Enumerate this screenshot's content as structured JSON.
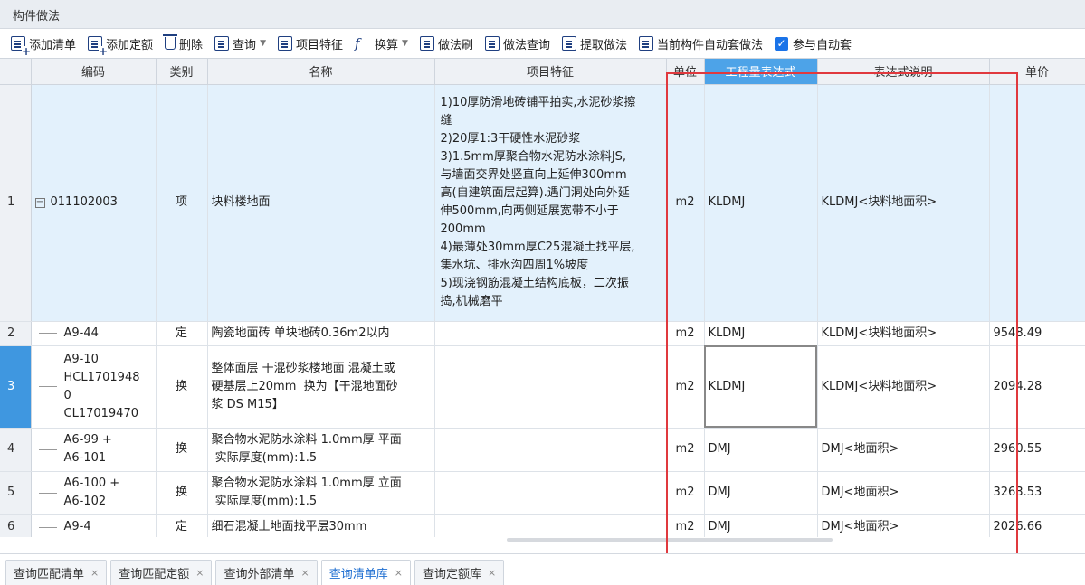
{
  "panel": {
    "title": "构件做法"
  },
  "toolbar": {
    "items": [
      {
        "label": "添加清单",
        "icon": "add-list-icon"
      },
      {
        "label": "添加定额",
        "icon": "add-quota-icon"
      },
      {
        "label": "删除",
        "icon": "trash-icon"
      },
      {
        "label": "查询",
        "icon": "query-icon"
      },
      {
        "label": "项目特征",
        "icon": "feature-icon"
      },
      {
        "label": "换算",
        "icon": "fx-icon"
      },
      {
        "label": "做法刷",
        "icon": "brush-icon"
      },
      {
        "label": "做法查询",
        "icon": "method-query-icon"
      },
      {
        "label": "提取做法",
        "icon": "extract-icon"
      },
      {
        "label": "当前构件自动套做法",
        "icon": "auto-apply-icon"
      },
      {
        "label": "参与自动套",
        "icon": "checkbox-checked-icon"
      }
    ],
    "checkbox_mark": "✓"
  },
  "table": {
    "headers": [
      "编码",
      "类别",
      "名称",
      "项目特征",
      "单位",
      "工程量表达式",
      "表达式说明",
      "单价"
    ],
    "rows": [
      {
        "num": "1",
        "code": "011102003",
        "type": "项",
        "name": "块料楼地面",
        "feature": "1)10厚防滑地砖铺平拍实,水泥砂浆擦\n缝\n2)20厚1:3干硬性水泥砂浆\n3)1.5mm厚聚合物水泥防水涂料JS,\n与墙面交界处竖直向上延伸300mm\n高(自建筑面层起算).遇门洞处向外延\n伸500mm,向两侧延展宽带不小于\n200mm\n4)最薄处30mm厚C25混凝土找平层,\n集水坑、排水沟四周1%坡度\n5)现浇钢筋混凝土结构底板，二次振\n捣,机械磨平",
        "unit": "m2",
        "expr": "KLDMJ",
        "desc": "KLDMJ<块料地面积>",
        "price": ""
      },
      {
        "num": "2",
        "code": "A9-44",
        "type": "定",
        "name": "陶瓷地面砖 单块地砖0.36m2以内",
        "feature": "",
        "unit": "m2",
        "expr": "KLDMJ",
        "desc": "KLDMJ<块料地面积>",
        "price": "9548.49"
      },
      {
        "num": "3",
        "code": "A9-10\nHCL1701948\n0\nCL17019470",
        "type": "换",
        "name": "整体面层 干混砂浆楼地面 混凝土或\n硬基层上20mm  换为【干混地面砂\n浆 DS M15】",
        "feature": "",
        "unit": "m2",
        "expr": "KLDMJ",
        "desc": "KLDMJ<块料地面积>",
        "price": "2094.28"
      },
      {
        "num": "4",
        "code": "A6-99 +\nA6-101",
        "type": "换",
        "name": "聚合物水泥防水涂料 1.0mm厚 平面\n 实际厚度(mm):1.5",
        "feature": "",
        "unit": "m2",
        "expr": "DMJ",
        "desc": "DMJ<地面积>",
        "price": "2960.55"
      },
      {
        "num": "5",
        "code": "A6-100 +\nA6-102",
        "type": "换",
        "name": "聚合物水泥防水涂料 1.0mm厚 立面\n 实际厚度(mm):1.5",
        "feature": "",
        "unit": "m2",
        "expr": "DMJ",
        "desc": "DMJ<地面积>",
        "price": "3263.53"
      },
      {
        "num": "6",
        "code": "A9-4",
        "type": "定",
        "name": "细石混凝土地面找平层30mm",
        "feature": "",
        "unit": "m2",
        "expr": "DMJ",
        "desc": "DMJ<地面积>",
        "price": "2026.66"
      }
    ],
    "collapse_glyph": "−"
  },
  "tabs": [
    {
      "label": "查询匹配清单",
      "active": false
    },
    {
      "label": "查询匹配定额",
      "active": false
    },
    {
      "label": "查询外部清单",
      "active": false
    },
    {
      "label": "查询清单库",
      "active": true
    },
    {
      "label": "查询定额库",
      "active": false
    }
  ],
  "tab_close_glyph": "×",
  "colors": {
    "highlight_box": "#e0393e",
    "accent": "#3f97e0",
    "selected_row": "#e3f1fc"
  }
}
